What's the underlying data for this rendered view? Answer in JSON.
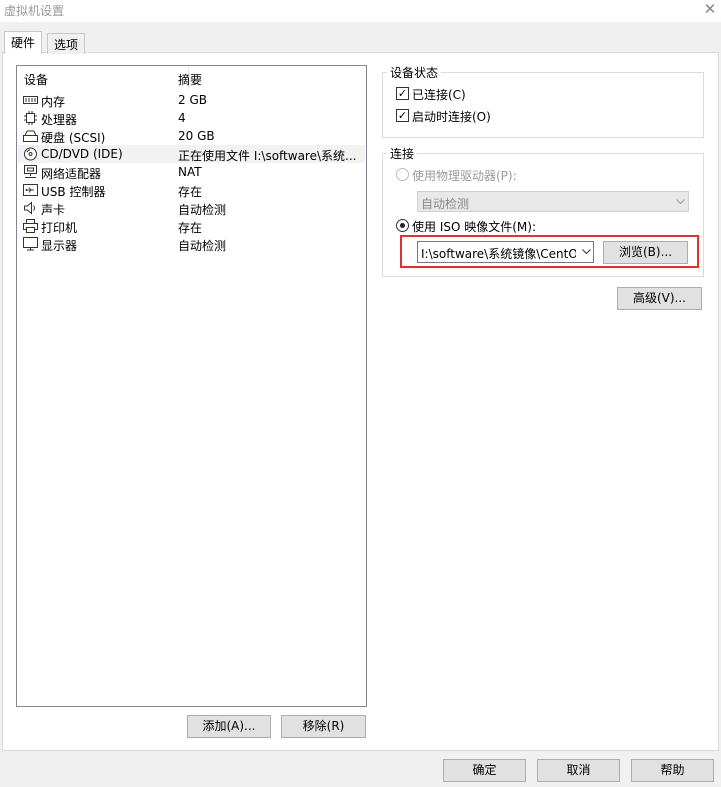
{
  "window": {
    "title": "虚拟机设置",
    "close_glyph": "✕"
  },
  "tabs": [
    {
      "label": "硬件"
    },
    {
      "label": "选项"
    }
  ],
  "device_list": {
    "col_device": "设备",
    "col_summary": "摘要",
    "rows": [
      {
        "name": "内存",
        "summary": "2 GB",
        "icon": "memory-icon"
      },
      {
        "name": "处理器",
        "summary": "4",
        "icon": "processor-icon"
      },
      {
        "name": "硬盘 (SCSI)",
        "summary": "20 GB",
        "icon": "hard-disk-icon"
      },
      {
        "name": "CD/DVD (IDE)",
        "summary": "正在使用文件 I:\\software\\系统...",
        "icon": "cd-dvd-icon",
        "selected": true
      },
      {
        "name": "网络适配器",
        "summary": "NAT",
        "icon": "network-adapter-icon"
      },
      {
        "name": "USB 控制器",
        "summary": "存在",
        "icon": "usb-controller-icon"
      },
      {
        "name": "声卡",
        "summary": "自动检测",
        "icon": "sound-card-icon"
      },
      {
        "name": "打印机",
        "summary": "存在",
        "icon": "printer-icon"
      },
      {
        "name": "显示器",
        "summary": "自动检测",
        "icon": "display-icon"
      }
    ],
    "add_button": "添加(A)...",
    "remove_button": "移除(R)"
  },
  "device_status": {
    "label": "设备状态",
    "connected": {
      "label": "已连接(C)",
      "checked": true
    },
    "connect_at_power_on": {
      "label": "启动时连接(O)",
      "checked": true
    }
  },
  "connection": {
    "label": "连接",
    "physical_drive": {
      "label": "使用物理驱动器(P):",
      "selected": false,
      "enabled": false
    },
    "physical_drive_select": {
      "value": "自动检测"
    },
    "iso_image": {
      "label": "使用 ISO 映像文件(M):",
      "selected": true
    },
    "iso_path": {
      "value": "I:\\software\\系统镜像\\CentO"
    },
    "browse_button": "浏览(B)..."
  },
  "advanced_button": "高级(V)...",
  "footer": {
    "ok": "确定",
    "cancel": "取消",
    "help": "帮助"
  },
  "colors": {
    "highlight_border": "#e03131",
    "panel_bg": "#ffffff",
    "window_bg": "#f0f0f0"
  }
}
